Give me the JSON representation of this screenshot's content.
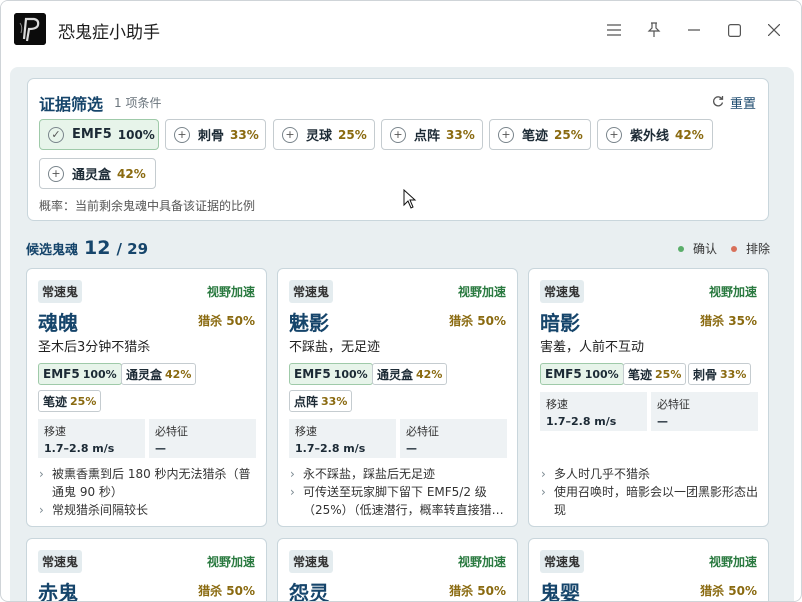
{
  "window": {
    "title": "恐鬼症小助手"
  },
  "filter": {
    "title": "证据筛选",
    "count": "1 项条件",
    "reset": "重置",
    "chips": [
      {
        "label": "EMF5",
        "pct": "100%",
        "selected": true
      },
      {
        "label": "刺骨",
        "pct": "33%",
        "selected": false
      },
      {
        "label": "灵球",
        "pct": "25%",
        "selected": false
      },
      {
        "label": "点阵",
        "pct": "33%",
        "selected": false
      },
      {
        "label": "笔迹",
        "pct": "25%",
        "selected": false
      },
      {
        "label": "紫外线",
        "pct": "42%",
        "selected": false
      },
      {
        "label": "通灵盒",
        "pct": "42%",
        "selected": false
      }
    ],
    "note": "概率：当前剩余鬼魂中具备该证据的比例"
  },
  "candidates": {
    "label": "候选鬼魂",
    "count": "12",
    "total": "/ 29",
    "confirm": "确认",
    "exclude": "排除",
    "confirm_color": "#5aae6a",
    "exclude_color": "#d8705a"
  },
  "cards": [
    {
      "type": "常速鬼",
      "speed": "视野加速",
      "name": "魂魄",
      "hunt": "猎杀 50%",
      "desc": "圣木后3分钟不猎杀",
      "evidence": [
        {
          "label": "EMF5",
          "pct": "100%"
        },
        {
          "label": "通灵盒",
          "pct": "42%"
        },
        {
          "label": "笔迹",
          "pct": "25%"
        }
      ],
      "move_label": "移速",
      "move_value": "1.7–2.8 m/s",
      "trait_label": "必特征",
      "trait_value": "—",
      "bullets": [
        "被熏香熏到后 180 秒内无法猎杀（普通鬼 90 秒）",
        "常规猎杀间隔较长"
      ]
    },
    {
      "type": "常速鬼",
      "speed": "视野加速",
      "name": "魅影",
      "hunt": "猎杀 50%",
      "desc": "不踩盐，无足迹",
      "evidence": [
        {
          "label": "EMF5",
          "pct": "100%"
        },
        {
          "label": "通灵盒",
          "pct": "42%"
        },
        {
          "label": "点阵",
          "pct": "33%"
        }
      ],
      "move_label": "移速",
      "move_value": "1.7–2.8 m/s",
      "trait_label": "必特征",
      "trait_value": "—",
      "bullets": [
        "永不踩盐，踩盐后无足迹",
        "可传送至玩家脚下留下 EMF5/2 级（25%）（低速潜行，概率转直接猎…"
      ]
    },
    {
      "type": "常速鬼",
      "speed": "视野加速",
      "name": "暗影",
      "hunt": "猎杀 35%",
      "desc": "害羞，人前不互动",
      "evidence": [
        {
          "label": "EMF5",
          "pct": "100%"
        },
        {
          "label": "笔迹",
          "pct": "25%"
        },
        {
          "label": "刺骨",
          "pct": "33%"
        }
      ],
      "move_label": "移速",
      "move_value": "1.7–2.8 m/s",
      "trait_label": "必特征",
      "trait_value": "—",
      "bullets": [
        "多人时几乎不猎杀",
        "使用召唤时，暗影会以一团黑影形态出现"
      ]
    },
    {
      "type": "常速鬼",
      "speed": "视野加速",
      "name": "赤鬼",
      "hunt": "猎杀 50%"
    },
    {
      "type": "常速鬼",
      "speed": "视野加速",
      "name": "怨灵",
      "hunt": "猎杀 50%"
    },
    {
      "type": "常速鬼",
      "speed": "视野加速",
      "name": "鬼婴",
      "hunt": "猎杀 50%"
    }
  ]
}
